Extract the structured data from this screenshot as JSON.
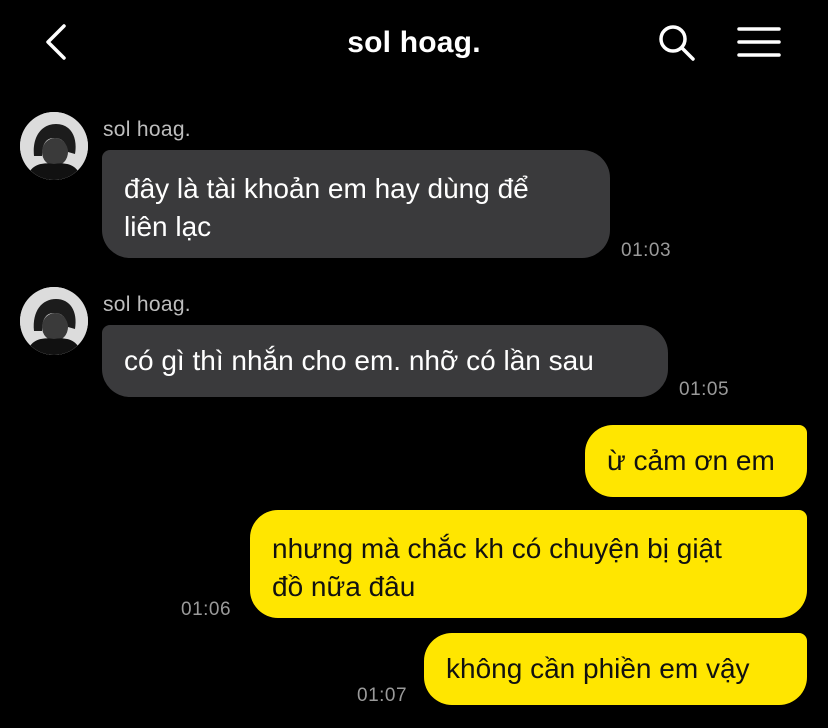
{
  "header": {
    "title": "sol hoag.",
    "back_icon": "chevron-left-icon",
    "search_icon": "search-icon",
    "menu_icon": "hamburger-menu-icon"
  },
  "colors": {
    "background": "#000000",
    "incoming_bubble": "#3a3a3c",
    "outgoing_bubble": "#ffe600",
    "timestamp": "#9a9a9a"
  },
  "messages": [
    {
      "direction": "incoming",
      "sender": "sol hoag.",
      "text": "đây là tài khoản em hay dùng để\nliên lạc",
      "time": "01:03"
    },
    {
      "direction": "incoming",
      "sender": "sol hoag.",
      "text": "có gì thì nhắn cho em. nhỡ có lần sau",
      "time": "01:05"
    },
    {
      "direction": "outgoing",
      "text": "ừ cảm ơn em",
      "time": ""
    },
    {
      "direction": "outgoing",
      "text": "nhưng mà chắc kh có chuyện bị giật\nđồ nữa đâu",
      "time": "01:06"
    },
    {
      "direction": "outgoing",
      "text": "không cần phiền em vậy",
      "time": "01:07"
    }
  ]
}
